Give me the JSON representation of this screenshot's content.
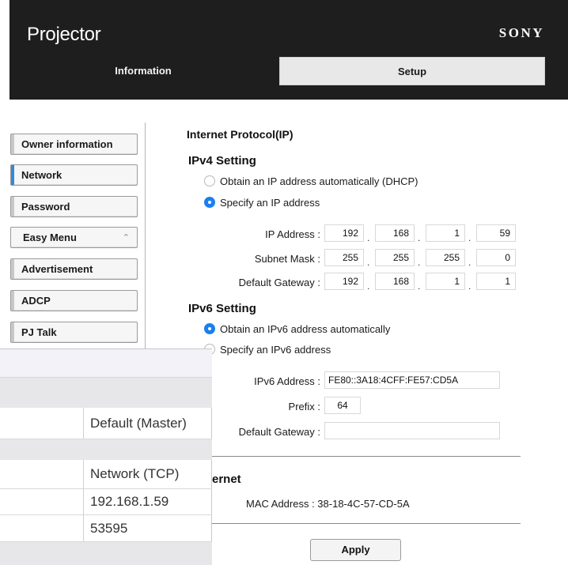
{
  "header": {
    "title": "Projector",
    "brand": "SONY",
    "tabs": [
      {
        "label": "Information"
      },
      {
        "label": "Setup"
      }
    ]
  },
  "sidebar": {
    "items": [
      {
        "label": "Owner information"
      },
      {
        "label": "Network"
      },
      {
        "label": "Password"
      },
      {
        "label": "Easy Menu"
      },
      {
        "label": "Advertisement"
      },
      {
        "label": "ADCP"
      },
      {
        "label": "PJ Talk"
      }
    ]
  },
  "main": {
    "section_title": "Internet Protocol(IP)",
    "ipv4": {
      "heading": "IPv4 Setting",
      "options": [
        {
          "label": "Obtain an IP address automatically (DHCP)",
          "selected": false
        },
        {
          "label": "Specify an IP address",
          "selected": true
        }
      ],
      "ip_label": "IP Address :",
      "ip": [
        "192",
        "168",
        "1",
        "59"
      ],
      "mask_label": "Subnet Mask :",
      "mask": [
        "255",
        "255",
        "255",
        "0"
      ],
      "gateway_label": "Default Gateway :",
      "gateway": [
        "192",
        "168",
        "1",
        "1"
      ]
    },
    "ipv6": {
      "heading": "IPv6 Setting",
      "options": [
        {
          "label": "Obtain an IPv6 address automatically",
          "selected": true
        },
        {
          "label": "Specify an IPv6 address",
          "selected": false
        }
      ],
      "address_label": "IPv6 Address :",
      "address": "FE80::3A18:4CFF:FE57:CD5A",
      "prefix_label": "Prefix :",
      "prefix": "64",
      "gateway_label": "Default Gateway :",
      "gateway": ""
    },
    "ethernet_heading_visible": "ernet",
    "mac_text": "MAC Address : 38-18-4C-57-CD-5A",
    "apply_label": "Apply"
  },
  "overlay": {
    "values": [
      "Default (Master)",
      "Network (TCP)",
      "192.168.1.59",
      "53595"
    ]
  },
  "colors": {
    "header_bg": "#1e1e1e",
    "accent_blue": "#1a7ff0"
  }
}
